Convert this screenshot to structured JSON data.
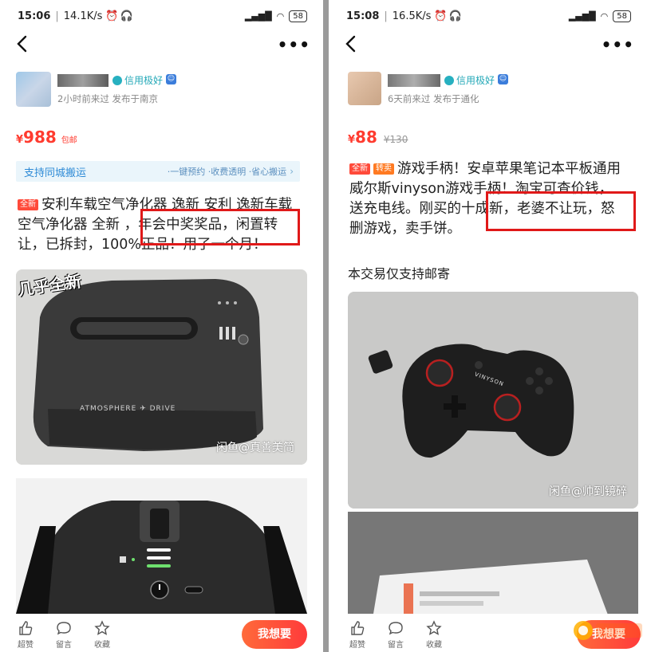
{
  "left": {
    "status": {
      "time": "15:06",
      "speed": "14.1K/s",
      "battery": "58"
    },
    "credit_label": "信用极好",
    "meta": "2小时前来过 发布于南京",
    "price": {
      "currency": "¥",
      "amount": "988",
      "tag": "包邮"
    },
    "banner": {
      "title": "支持同城搬运",
      "items": "·一键预约 ·收费透明 ·省心搬运",
      "chevron": "›"
    },
    "badge": "全新",
    "desc": "安利车载空气净化器 逸新 安利 逸新车载空气净化器 全新 ，年会中奖奖品，闲置转让，已拆封，100%正品！用了一个月！",
    "photo1_label": "几乎全新",
    "photo1_brand": "ATMOSPHERE ✈ DRIVE",
    "watermark": "闲鱼@真善美简",
    "bottom": {
      "like": "超赞",
      "comment": "留言",
      "fav": "收藏",
      "want": "我想要"
    }
  },
  "right": {
    "status": {
      "time": "15:08",
      "speed": "16.5K/s",
      "battery": "58"
    },
    "credit_label": "信用极好",
    "meta": "6天前来过 发布于通化",
    "price": {
      "currency": "¥",
      "amount": "88",
      "original": "¥130"
    },
    "badges": [
      "全新",
      "转卖"
    ],
    "desc": "游戏手柄！安卓苹果笔记本平板通用 威尔斯vinyson游戏手柄！淘宝可查价钱，送充电线。刚买的十成新，老婆不让玩，怒删游戏，卖手饼。",
    "note": "本交易仅支持邮寄",
    "controller_brand": "VINYSON",
    "watermark": "闲鱼@帅到镜碎",
    "bottom": {
      "like": "超赞",
      "comment": "留言",
      "fav": "收藏",
      "want": "我想要"
    }
  },
  "colors": {
    "price": "#ff3b2f",
    "highlight": "#e01919",
    "credit": "#25a9b8",
    "want_button": "#ff4a3a"
  }
}
